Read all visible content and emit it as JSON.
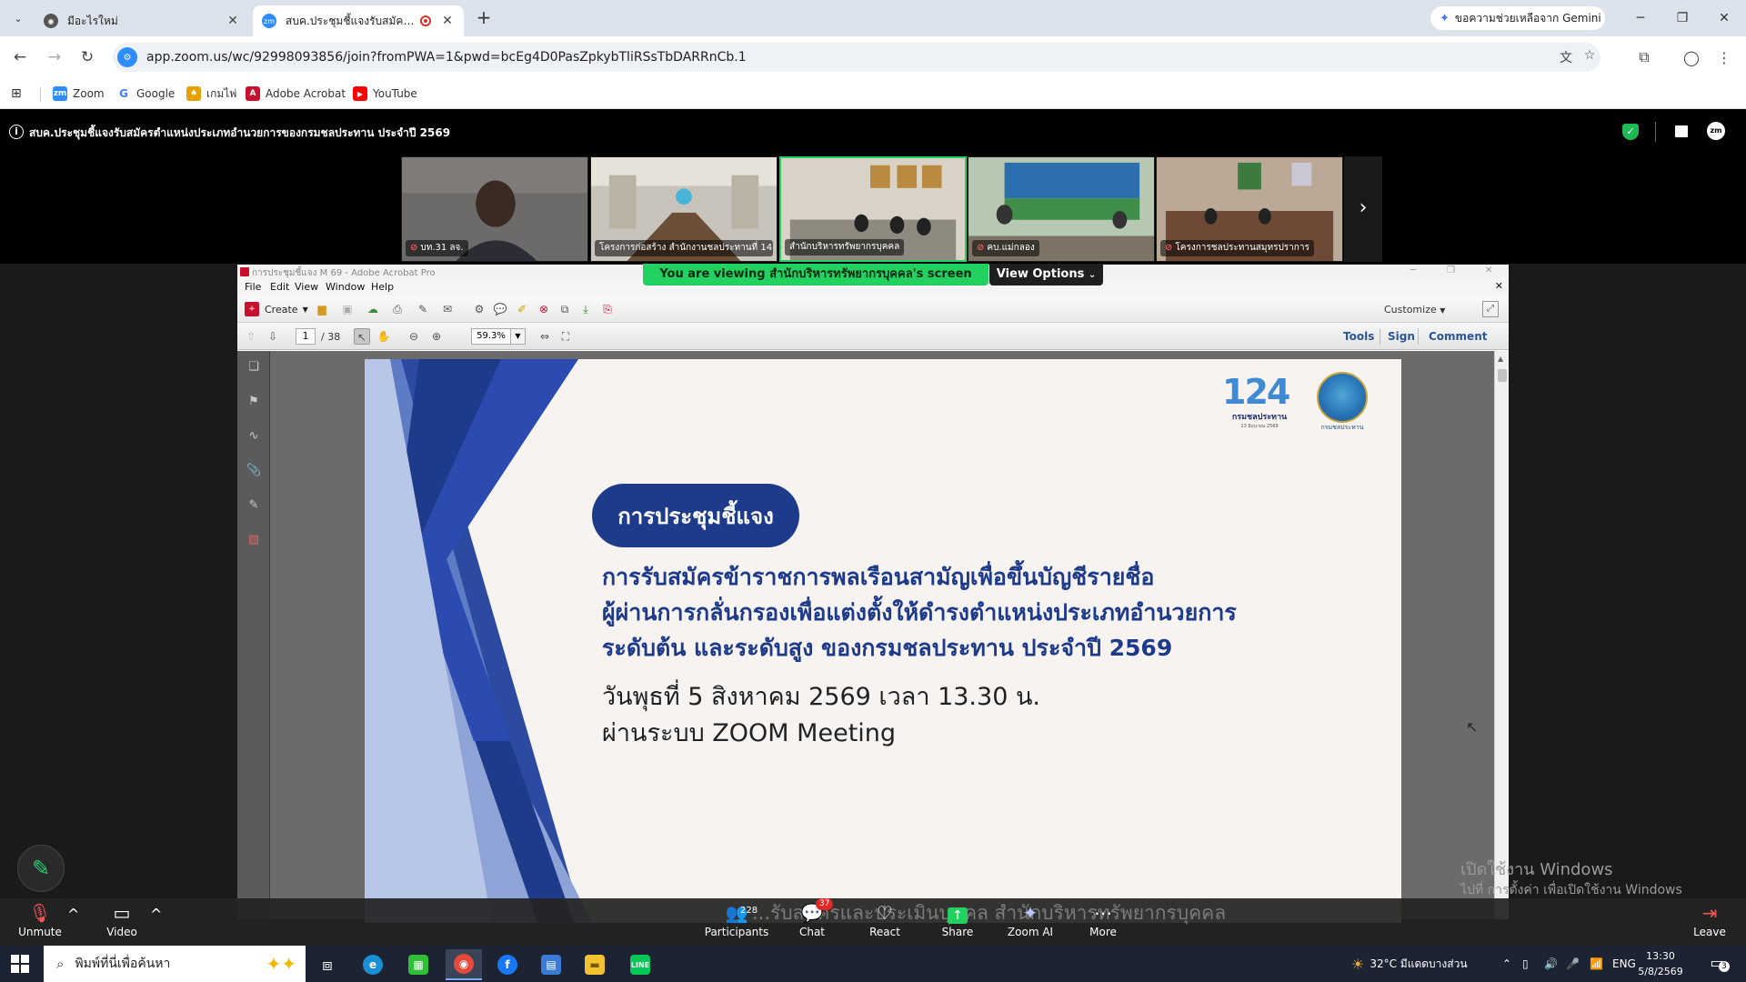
{
  "browser": {
    "tabs": [
      {
        "title": "มีอะไรใหม่",
        "favicon": "chrome-icon",
        "active": false
      },
      {
        "title": "สบค.ประชุมชี้แจงรับสมัครตำแหน่ง",
        "favicon": "zoom-icon",
        "active": true
      }
    ],
    "gemini_label": "ขอความช่วยเหลือจาก Gemini",
    "url": "app.zoom.us/wc/92998093856/join?fromPWA=1&pwd=bcEg4D0PasZpkybTliRSsTbDARRnCb.1",
    "bookmarks": [
      {
        "label": "Zoom",
        "icon": "zoom-icon",
        "color": "#2d8cff"
      },
      {
        "label": "Google",
        "icon": "google-icon",
        "color": "#4285f4"
      },
      {
        "label": "เกมไพ่",
        "icon": "cards-icon",
        "color": "#e6a100"
      },
      {
        "label": "Adobe Acrobat",
        "icon": "acrobat-icon",
        "color": "#c8102e"
      },
      {
        "label": "YouTube",
        "icon": "youtube-icon",
        "color": "#ff0000"
      }
    ]
  },
  "meeting": {
    "title": "สบค.ประชุมชี้แจงรับสมัครตำแหน่งประเภทอำนวยการของกรมชลประทาน ประจำปี 2569",
    "participants_strip": [
      {
        "name": "บท.31 ลจ.",
        "muted": true,
        "active": false
      },
      {
        "name": "โครงการก่อสร้าง สำนักงานชลประทานที่ 14",
        "muted": false,
        "active": false
      },
      {
        "name": "สำนักบริหารทรัพยากรบุคคล",
        "muted": false,
        "active": true
      },
      {
        "name": "คบ.แม่กลอง",
        "muted": true,
        "active": false
      },
      {
        "name": "โครงการชลประทานสมุทรปราการ",
        "muted": true,
        "active": false
      }
    ],
    "viewing_banner": "You are viewing  สำนักบริหารทรัพยากรบุคคล's screen",
    "view_options_label": "View Options",
    "caption_text": "...รับสมัครและประเมินบุคคล สำนักบริหารทรัพยากรบุคคล",
    "toolbar": {
      "unmute": "Unmute",
      "video": "Video",
      "participants": "Participants",
      "participants_count": "228",
      "chat": "Chat",
      "chat_badge": "37",
      "react": "React",
      "share": "Share",
      "zoom_ai": "Zoom AI",
      "more": "More",
      "leave": "Leave"
    }
  },
  "acrobat": {
    "window_title": "การประชุมชี้แจง M 69 - Adobe Acrobat Pro",
    "menu": [
      "File",
      "Edit",
      "View",
      "Window",
      "Help"
    ],
    "create_label": "Create",
    "customize_label": "Customize",
    "page_current": "1",
    "page_total": "/ 38",
    "zoom_value": "59.3%",
    "panes": [
      "Tools",
      "Sign",
      "Comment"
    ]
  },
  "slide": {
    "logo_number": "124",
    "logo_caption": "กรมชลประทาน",
    "logo_small": "13 มิถุนายน 2569",
    "seal_caption": "กรมชลประทาน",
    "badge": "การประชุมชี้แจง",
    "headline": [
      "การรับสมัครข้าราชการพลเรือนสามัญเพื่อขึ้นบัญชีรายชื่อ",
      "ผู้ผ่านการกลั่นกรองเพื่อแต่งตั้งให้ดำรงตำแหน่งประเภทอำนวยการ",
      "ระดับต้น และระดับสูง ของกรมชลประทาน ประจำปี 2569"
    ],
    "date_lines": [
      "วันพุธที่ 5 สิงหาคม 2569 เวลา 13.30 น.",
      "ผ่านระบบ ZOOM Meeting"
    ]
  },
  "windows_activation": {
    "line1": "เปิดใช้งาน Windows",
    "line2": "ไปที่ การตั้งค่า เพื่อเปิดใช้งาน Windows"
  },
  "taskbar": {
    "search_placeholder": "พิมพ์ที่นี่เพื่อค้นหา",
    "weather": "32°C  มีแดดบางส่วน",
    "language": "ENG",
    "time": "13:30",
    "date": "5/8/2569",
    "notification_count": "3"
  },
  "colors": {
    "zoom_green": "#23d160",
    "slide_navy": "#1e3a8a",
    "muted_red": "#f25a5a"
  }
}
